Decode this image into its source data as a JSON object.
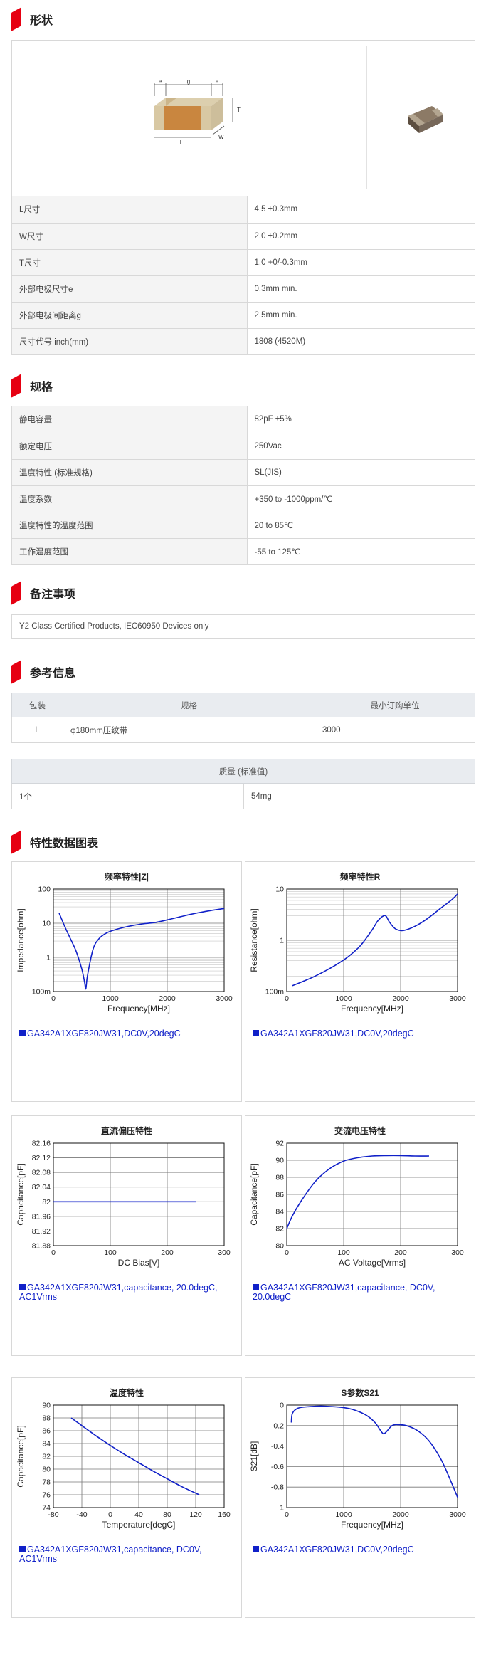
{
  "sections": {
    "shape": "形状",
    "spec": "规格",
    "notes": "备注事项",
    "reference": "参考信息",
    "charts": "特性数据图表"
  },
  "diagram": {
    "e": "e",
    "g": "g",
    "t": "T",
    "l": "L",
    "w": "W"
  },
  "shape_table": [
    {
      "k": "L尺寸",
      "v": "4.5 ±0.3mm"
    },
    {
      "k": "W尺寸",
      "v": "2.0 ±0.2mm"
    },
    {
      "k": "T尺寸",
      "v": "1.0 +0/-0.3mm"
    },
    {
      "k": "外部电极尺寸e",
      "v": "0.3mm min."
    },
    {
      "k": "外部电极间距离g",
      "v": "2.5mm min."
    },
    {
      "k": "尺寸代号 inch(mm)",
      "v": "1808 (4520M)"
    }
  ],
  "spec_table": [
    {
      "k": "静电容量",
      "v": "82pF ±5%"
    },
    {
      "k": "额定电压",
      "v": "250Vac"
    },
    {
      "k": "温度特性 (标准规格)",
      "v": "SL(JIS)"
    },
    {
      "k": "温度系数",
      "v": "+350 to -1000ppm/℃"
    },
    {
      "k": "温度特性的温度范围",
      "v": "20 to 85℃"
    },
    {
      "k": "工作温度范围",
      "v": "-55 to 125℃"
    }
  ],
  "notes_text": "Y2 Class Certified Products, IEC60950 Devices only",
  "packaging": {
    "headers": [
      "包装",
      "规格",
      "最小订购单位"
    ],
    "row": [
      "L",
      "φ180mm压纹带",
      "3000"
    ]
  },
  "mass": {
    "header": "质量 (标准值)",
    "row": [
      "1个",
      "54mg"
    ]
  },
  "colors": {
    "accent": "#e60012",
    "curve": "#1020c8"
  },
  "charts": [
    {
      "title": "频率特性|Z|",
      "legend": "GA342A1XGF820JW31,DC0V,20degC",
      "chart_data": {
        "type": "line",
        "xlabel": "Frequency[MHz]",
        "ylabel": "Impedance[ohm]",
        "xlim": [
          0,
          3000
        ],
        "ylim": [
          0.1,
          100
        ],
        "yscale": "log",
        "xticks": [
          "0",
          "1000",
          "2000",
          "3000"
        ],
        "yticks": [
          "100m",
          "1",
          "10",
          "100"
        ],
        "x": [
          100,
          200,
          300,
          400,
          500,
          550,
          570,
          600,
          700,
          800,
          900,
          1000,
          1200,
          1400,
          1600,
          1800,
          2000,
          2200,
          2400,
          2600,
          2800,
          3000
        ],
        "y": [
          20,
          8,
          3.5,
          1.5,
          0.45,
          0.18,
          0.12,
          0.3,
          1.8,
          3.5,
          4.8,
          5.8,
          7.3,
          8.6,
          9.7,
          10.6,
          12.5,
          15,
          18,
          21,
          24,
          27
        ]
      }
    },
    {
      "title": "频率特性R",
      "legend": "GA342A1XGF820JW31,DC0V,20degC",
      "chart_data": {
        "type": "line",
        "xlabel": "Frequency[MHz]",
        "ylabel": "Resistance[ohm]",
        "xlim": [
          0,
          3000
        ],
        "ylim": [
          0.1,
          10
        ],
        "yscale": "log",
        "xticks": [
          "0",
          "1000",
          "2000",
          "3000"
        ],
        "yticks": [
          "100m",
          "1",
          "10"
        ],
        "x": [
          100,
          300,
          500,
          700,
          900,
          1100,
          1300,
          1500,
          1600,
          1700,
          1750,
          1800,
          1900,
          2000,
          2100,
          2300,
          2500,
          2700,
          2900,
          3000
        ],
        "y": [
          0.13,
          0.16,
          0.2,
          0.26,
          0.35,
          0.5,
          0.8,
          1.6,
          2.4,
          3.0,
          2.9,
          2.3,
          1.7,
          1.55,
          1.6,
          2.0,
          2.8,
          4.2,
          6.2,
          8.0
        ]
      }
    },
    {
      "title": "直流偏压特性",
      "legend": "GA342A1XGF820JW31,capacitance, 20.0degC, AC1Vrms",
      "chart_data": {
        "type": "line",
        "xlabel": "DC Bias[V]",
        "ylabel": "Capacitance[pF]",
        "xlim": [
          0,
          300
        ],
        "ylim": [
          81.88,
          82.16
        ],
        "xticks": [
          "0",
          "100",
          "200",
          "300"
        ],
        "yticks": [
          "81.88",
          "81.92",
          "81.96",
          "82",
          "82.04",
          "82.08",
          "82.12",
          "82.16"
        ],
        "x": [
          0,
          50,
          100,
          150,
          200,
          250
        ],
        "y": [
          82,
          82,
          82,
          82,
          82,
          82
        ]
      }
    },
    {
      "title": "交流电压特性",
      "legend": "GA342A1XGF820JW31,capacitance, DC0V, 20.0degC",
      "chart_data": {
        "type": "line",
        "xlabel": "AC Voltage[Vrms]",
        "ylabel": "Capacitance[pF]",
        "xlim": [
          0,
          300
        ],
        "ylim": [
          80,
          92
        ],
        "xticks": [
          "0",
          "100",
          "200",
          "300"
        ],
        "yticks": [
          "80",
          "82",
          "84",
          "86",
          "88",
          "90",
          "92"
        ],
        "x": [
          0,
          10,
          25,
          50,
          75,
          100,
          125,
          150,
          175,
          200,
          225,
          250
        ],
        "y": [
          82,
          83.5,
          85.2,
          87.5,
          89,
          89.9,
          90.3,
          90.5,
          90.55,
          90.55,
          90.5,
          90.5
        ]
      }
    },
    {
      "title": "温度特性",
      "legend": "GA342A1XGF820JW31,capacitance, DC0V, AC1Vrms",
      "chart_data": {
        "type": "line",
        "xlabel": "Temperature[degC]",
        "ylabel": "Capacitance[pF]",
        "xlim": [
          -80,
          160
        ],
        "ylim": [
          74,
          90
        ],
        "xticks": [
          "-80",
          "-40",
          "0",
          "40",
          "80",
          "120",
          "160"
        ],
        "yticks": [
          "74",
          "76",
          "78",
          "80",
          "82",
          "84",
          "86",
          "88",
          "90"
        ],
        "x": [
          -55,
          -40,
          -20,
          0,
          20,
          40,
          60,
          80,
          100,
          125
        ],
        "y": [
          88,
          86.8,
          85.2,
          83.7,
          82.3,
          81,
          79.7,
          78.5,
          77.3,
          76
        ]
      }
    },
    {
      "title": "S参数S21",
      "legend": "GA342A1XGF820JW31,DC0V,20degC",
      "chart_data": {
        "type": "line",
        "xlabel": "Frequency[MHz]",
        "ylabel": "S21[dB]",
        "xlim": [
          0,
          3000
        ],
        "ylim": [
          -1,
          0
        ],
        "xticks": [
          "0",
          "1000",
          "2000",
          "3000"
        ],
        "yticks": [
          "-1",
          "-0.8",
          "-0.6",
          "-0.4",
          "-0.2",
          "0"
        ],
        "x": [
          80,
          100,
          200,
          400,
          600,
          800,
          1000,
          1200,
          1400,
          1550,
          1650,
          1700,
          1750,
          1850,
          1950,
          2100,
          2300,
          2500,
          2700,
          2850,
          3000
        ],
        "y": [
          -0.17,
          -0.08,
          -0.03,
          -0.015,
          -0.01,
          -0.015,
          -0.025,
          -0.05,
          -0.1,
          -0.17,
          -0.25,
          -0.28,
          -0.26,
          -0.2,
          -0.19,
          -0.2,
          -0.25,
          -0.35,
          -0.52,
          -0.7,
          -0.9
        ]
      }
    }
  ]
}
